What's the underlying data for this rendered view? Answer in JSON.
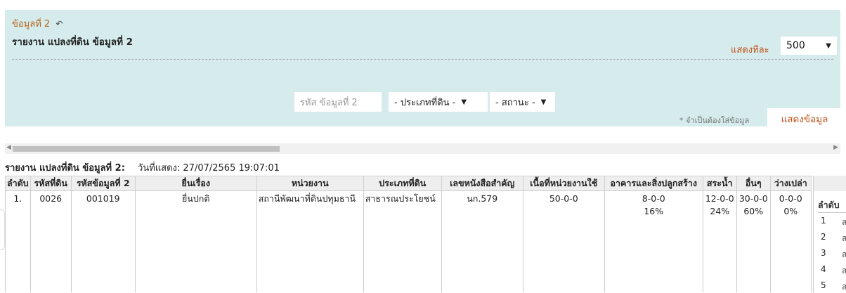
{
  "panel": {
    "breadcrumb": "ข้อมูลที่ 2",
    "back_icon": "↶",
    "title": "รายงาน แปลงที่ดิน ข้อมูลที่ 2",
    "show_label": "แสดงทีละ",
    "show_value": "500",
    "code_placeholder": "รหัส ข้อมูลที่ 2",
    "land_type_select": "- ประเภทที่ดิน -",
    "status_select": "- สถานะ -",
    "required_note": "* จำเป็นต้องใส่ข้อมูล",
    "show_button": "แสดงข้อมูล"
  },
  "report": {
    "title": "รายงาน แปลงที่ดิน ข้อมูลที่ 2:",
    "date_text": "วันที่แสดง: 27/07/2565 19:07:01"
  },
  "table": {
    "headers": [
      "ลำดับ",
      "รหัสที่ดิน",
      "รหัสข้อมูลที่ 2",
      "ยื่นเรื่อง",
      "หน่วยงาน",
      "ประเภทที่ดิน",
      "เลขหนังสือสำคัญ",
      "เนื้อที่หน่วยงานใช้",
      "อาคารและสิ่งปลูกสร้าง",
      "สระน้ำ",
      "อื่นๆ",
      "ว่างเปล่า"
    ],
    "row": {
      "no": "1.",
      "land_code": "0026",
      "data_code": "001019",
      "submit": "ยื่นปกติ",
      "agency": "สถานีพัฒนาที่ดินปทุมธานี",
      "land_type": "สาธารณประโยชน์",
      "doc_no": "นก.579",
      "area_used": "50-0-0",
      "building": "8-0-0",
      "building_pct": "16%",
      "pond": "12-0-0",
      "pond_pct": "24%",
      "other": "30-0-0",
      "other_pct": "60%",
      "vacant": "0-0-0",
      "vacant_pct": "0%"
    }
  },
  "side_table": {
    "title": "ลำดับ",
    "rows": [
      "1",
      "2",
      "3",
      "4",
      "5"
    ],
    "cells": [
      "ส",
      "ส",
      "ส",
      "ส",
      "ส"
    ]
  },
  "colors": {
    "panel_bg": "#d6ecec",
    "accent": "#c0541e"
  }
}
